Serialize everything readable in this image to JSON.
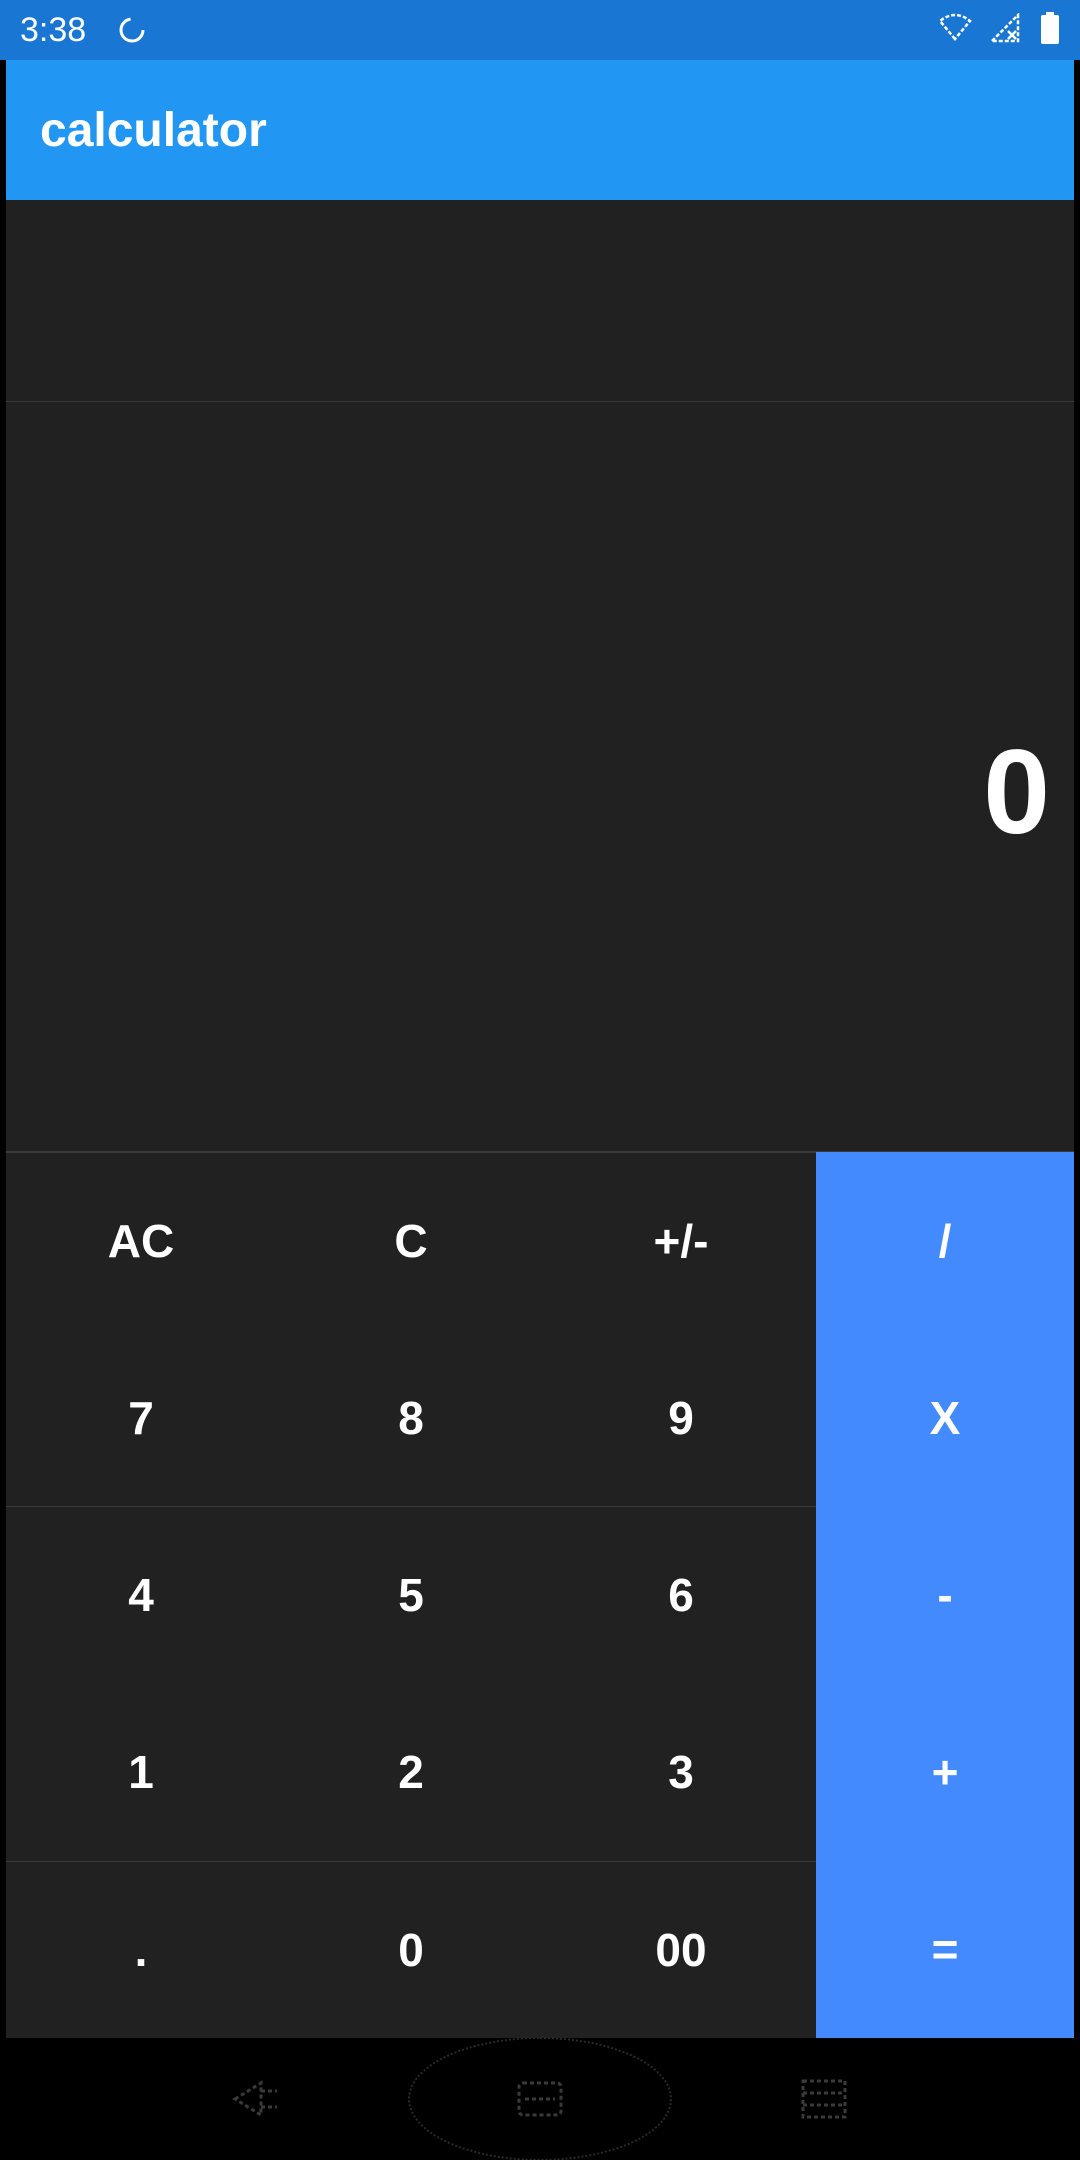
{
  "status_bar": {
    "time": "3:38",
    "icons": [
      "sync-icon",
      "wifi-icon",
      "no-signal-icon",
      "battery-icon"
    ]
  },
  "app_bar": {
    "title": "calculator"
  },
  "display": {
    "history": "",
    "result": "0"
  },
  "keypad": {
    "rows": [
      [
        "AC",
        "C",
        "+/-",
        "/"
      ],
      [
        "7",
        "8",
        "9",
        "X"
      ],
      [
        "4",
        "5",
        "6",
        "-"
      ],
      [
        "1",
        "2",
        "3",
        "+"
      ],
      [
        ".",
        "0",
        "00",
        "="
      ]
    ]
  },
  "colors": {
    "status_bar": "#1976d2",
    "app_bar": "#2196f3",
    "display_background": "#212121",
    "operator_key": "#448aff",
    "text": "#ffffff"
  },
  "nav_bar": {
    "icons": [
      "back-icon",
      "home-icon",
      "recents-icon"
    ]
  }
}
